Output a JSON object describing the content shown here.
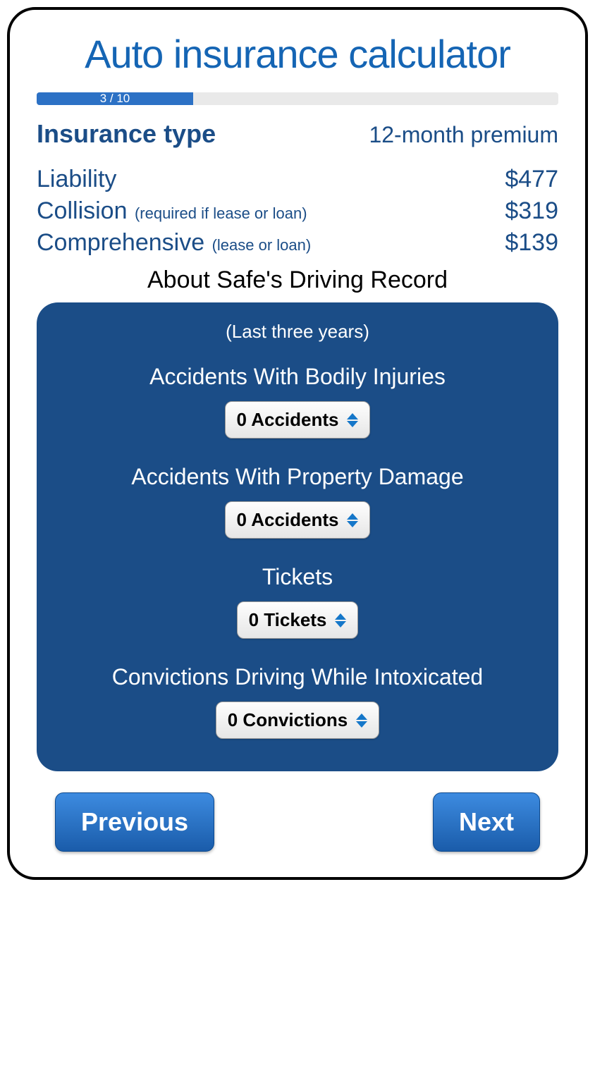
{
  "title": "Auto insurance calculator",
  "progress": {
    "label": "3 / 10",
    "percent": 30
  },
  "headers": {
    "left": "Insurance type",
    "right": "12-month premium"
  },
  "premiums": [
    {
      "label": "Liability",
      "note": "",
      "value": "$477"
    },
    {
      "label": "Collision",
      "note": "(required if lease or loan)",
      "value": "$319"
    },
    {
      "label": "Comprehensive",
      "note": "(lease or loan)",
      "value": "$139"
    }
  ],
  "section": {
    "heading": "About Safe's Driving Record",
    "subheading": "(Last three years)",
    "fields": [
      {
        "label": "Accidents With Bodily Injuries",
        "selected": "0 Accidents"
      },
      {
        "label": "Accidents With Property Damage",
        "selected": "0 Accidents"
      },
      {
        "label": "Tickets",
        "selected": "0 Tickets"
      },
      {
        "label": "Convictions Driving While Intoxicated",
        "selected": "0 Convictions"
      }
    ]
  },
  "nav": {
    "prev": "Previous",
    "next": "Next"
  }
}
